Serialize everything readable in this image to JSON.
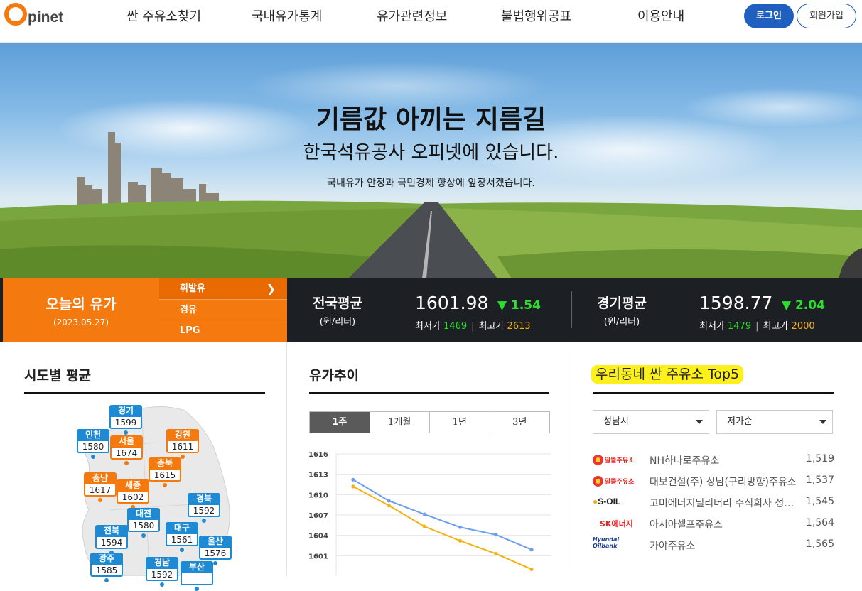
{
  "header": {
    "logo_text": "pinet",
    "nav": [
      "싼 주유소찾기",
      "국내유가통계",
      "유가관련정보",
      "불법행위공표",
      "이용안내"
    ],
    "login_label": "로그인",
    "join_label": "회원가입"
  },
  "hero": {
    "title": "기름값 아끼는 지름길",
    "subtitle": "한국석유공사 오피넷에 있습니다.",
    "description": "국내유가 안정과 국민경제 향상에 앞장서겠습니다."
  },
  "today": {
    "title": "오늘의 유가",
    "date": "(2023.05.27)",
    "fuels": [
      "휘발유",
      "경유",
      "LPG"
    ],
    "active_fuel": "휘발유",
    "national": {
      "label": "전국평균",
      "unit": "(원/리터)",
      "value": "1601.98",
      "change": "▼ 1.54",
      "low_label": "최저가",
      "low": "1469",
      "high_label": "최고가",
      "high": "2613"
    },
    "region": {
      "label": "경기평균",
      "unit": "(원/리터)",
      "value": "1598.77",
      "change": "▼ 2.04",
      "low_label": "최저가",
      "low": "1479",
      "high_label": "최고가",
      "high": "2000"
    }
  },
  "sido": {
    "title": "시도별 평균",
    "regions": [
      {
        "name": "경기",
        "value": "1599",
        "color": "blue"
      },
      {
        "name": "인천",
        "value": "1580",
        "color": "blue"
      },
      {
        "name": "서울",
        "value": "1674",
        "color": "orange"
      },
      {
        "name": "강원",
        "value": "1611",
        "color": "orange"
      },
      {
        "name": "충북",
        "value": "1615",
        "color": "orange"
      },
      {
        "name": "충남",
        "value": "1617",
        "color": "orange"
      },
      {
        "name": "세종",
        "value": "1602",
        "color": "orange"
      },
      {
        "name": "경북",
        "value": "1592",
        "color": "blue"
      },
      {
        "name": "대전",
        "value": "1580",
        "color": "blue"
      },
      {
        "name": "전북",
        "value": "1594",
        "color": "blue"
      },
      {
        "name": "대구",
        "value": "1561",
        "color": "blue"
      },
      {
        "name": "울산",
        "value": "1576",
        "color": "blue"
      },
      {
        "name": "광주",
        "value": "1585",
        "color": "blue"
      },
      {
        "name": "경남",
        "value": "1592",
        "color": "blue"
      },
      {
        "name": "부산",
        "value": "",
        "color": "blue"
      }
    ]
  },
  "trend": {
    "title": "유가추이",
    "tabs": [
      "1주",
      "1개월",
      "1년",
      "3년"
    ],
    "active_tab": "1주"
  },
  "chart_data": {
    "type": "line",
    "yticks": [
      1601,
      1604,
      1607,
      1610,
      1613,
      1616
    ],
    "ylim": [
      1598,
      1616
    ],
    "series": [
      {
        "values": [
          1612.2,
          1609.1,
          1607.1,
          1605.2,
          1604.1,
          1601.9
        ],
        "color": "#6d9ef0"
      },
      {
        "values": [
          1611.2,
          1608.4,
          1605.3,
          1603.2,
          1601.3,
          1599.0
        ],
        "color": "#f5b013"
      }
    ]
  },
  "top5": {
    "title": "우리동네 싼 주유소 Top5",
    "city_select": "성남시",
    "sort_select": "저가순",
    "stations": [
      {
        "brand": "nh-alttul-logo",
        "brand_text": "알뜰주유소",
        "name": "NH하나로주유소",
        "price": "1,519"
      },
      {
        "brand": "alttul-logo",
        "brand_text": "알뜰주유소",
        "name": "대보건설(주) 성남(구리방향)주유소",
        "price": "1,537"
      },
      {
        "brand": "s-oil-logo",
        "brand_text": "S-OIL",
        "name": "고미에너지딜리버리 주식회사 성…",
        "price": "1,545"
      },
      {
        "brand": "sk-energy-logo",
        "brand_text": "SK에너지",
        "name": "아시아셀프주유소",
        "price": "1,564"
      },
      {
        "brand": "hyundai-oilbank-logo",
        "brand_text": "Hyundai Oilbank",
        "name": "가야주유소",
        "price": "1,565"
      }
    ]
  }
}
